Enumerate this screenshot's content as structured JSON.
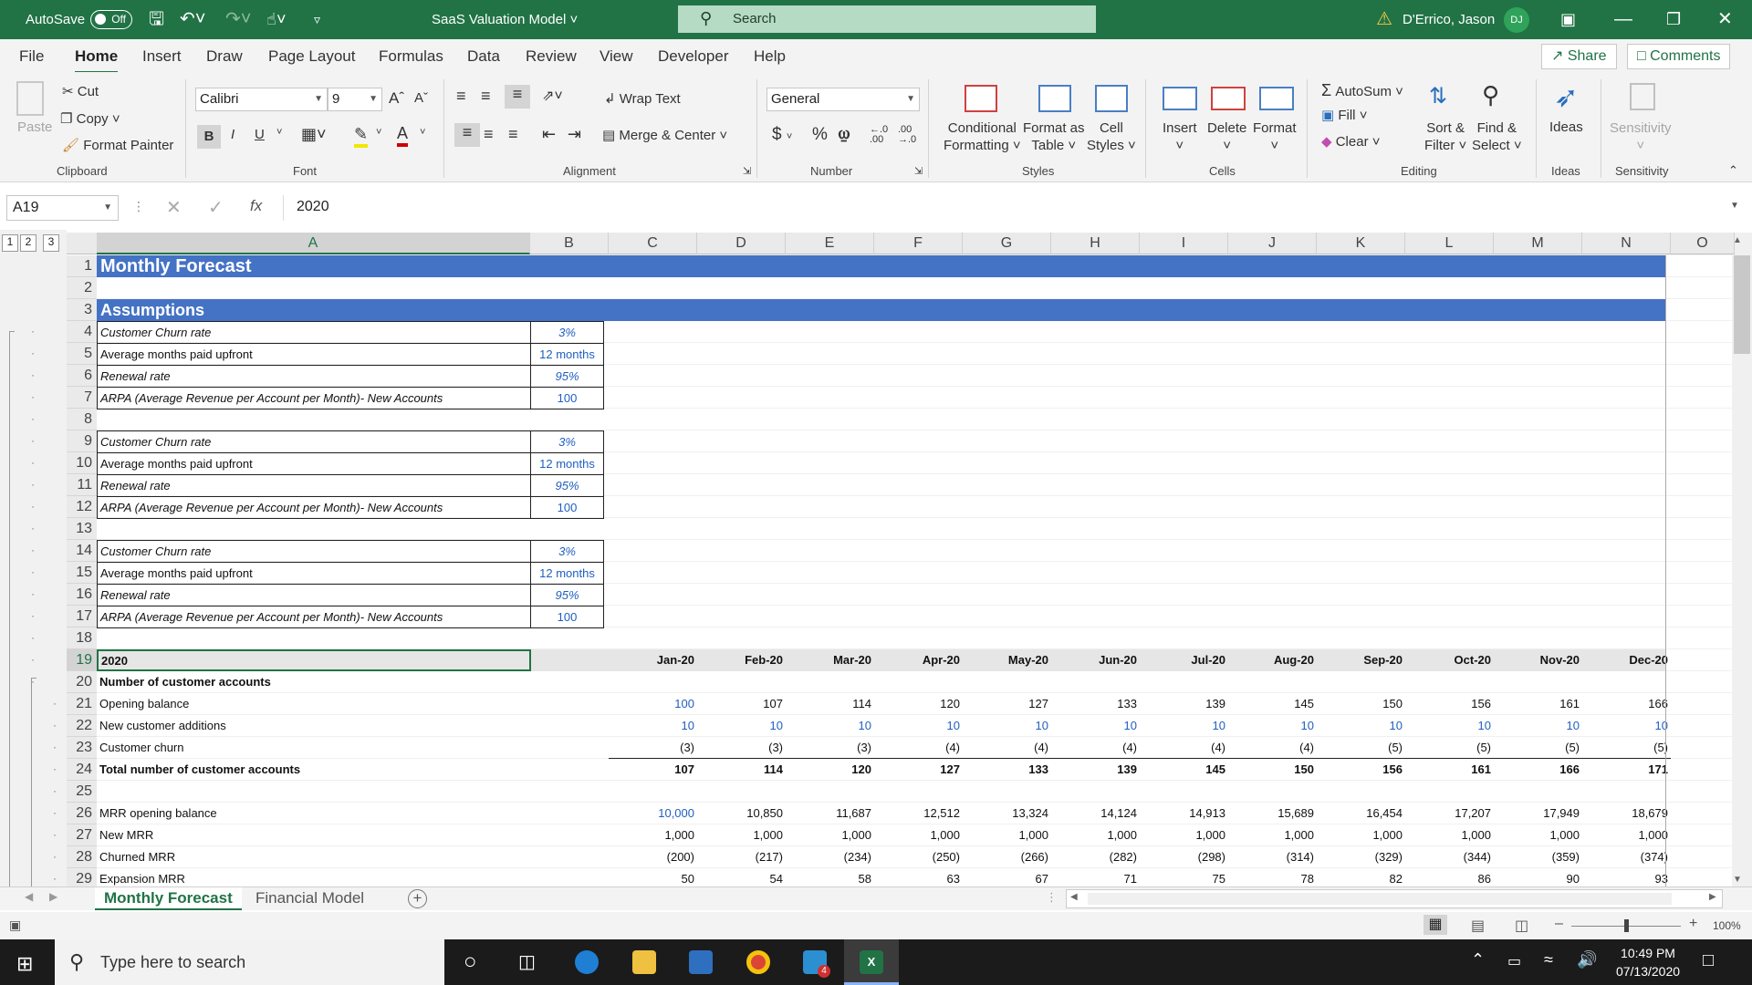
{
  "titlebar": {
    "autosave_label": "AutoSave",
    "autosave_state": "Off",
    "doc_title": "SaaS Valuation Model",
    "search_placeholder": "Search",
    "user_name": "D'Errico, Jason",
    "user_initials": "DJ"
  },
  "menu": {
    "tabs": [
      "File",
      "Home",
      "Insert",
      "Draw",
      "Page Layout",
      "Formulas",
      "Data",
      "Review",
      "View",
      "Developer",
      "Help"
    ],
    "active": "Home",
    "share": "Share",
    "comments": "Comments"
  },
  "ribbon": {
    "clipboard": {
      "paste": "Paste",
      "cut": "Cut",
      "copy": "Copy",
      "format_painter": "Format Painter",
      "label": "Clipboard"
    },
    "font": {
      "name": "Calibri",
      "size": "9",
      "label": "Font",
      "bold": "B",
      "italic": "I",
      "underline": "U"
    },
    "alignment": {
      "wrap": "Wrap Text",
      "merge": "Merge & Center",
      "label": "Alignment"
    },
    "number": {
      "format": "General",
      "label": "Number"
    },
    "styles": {
      "conditional": "Conditional",
      "conditional2": "Formatting",
      "format_as": "Format as",
      "format_as2": "Table",
      "cell_styles": "Cell",
      "cell_styles2": "Styles",
      "label": "Styles"
    },
    "cells": {
      "insert": "Insert",
      "delete": "Delete",
      "format": "Format",
      "label": "Cells"
    },
    "editing": {
      "autosum": "AutoSum",
      "fill": "Fill",
      "clear": "Clear",
      "sort": "Sort &",
      "sort2": "Filter",
      "find": "Find &",
      "find2": "Select",
      "label": "Editing"
    },
    "ideas": {
      "ideas": "Ideas",
      "label": "Ideas"
    },
    "sensitivity": {
      "sensitivity": "Sensitivity",
      "label": "Sensitivity"
    }
  },
  "formula": {
    "namebox": "A19",
    "value": "2020"
  },
  "outline_levels": [
    "1",
    "2",
    "3"
  ],
  "columns": [
    "A",
    "B",
    "C",
    "D",
    "E",
    "F",
    "G",
    "H",
    "I",
    "J",
    "K",
    "L",
    "M",
    "N",
    "O"
  ],
  "rows": [
    "1",
    "2",
    "3",
    "4",
    "5",
    "6",
    "7",
    "8",
    "9",
    "10",
    "11",
    "12",
    "13",
    "14",
    "15",
    "16",
    "17",
    "18",
    "19",
    "20",
    "21",
    "22",
    "23",
    "24",
    "25",
    "26",
    "27",
    "28",
    "29"
  ],
  "sheet": {
    "r1": "Monthly Forecast",
    "r3": "Assumptions",
    "assumption_blocks": [
      [
        [
          "Customer Churn rate",
          "3%"
        ],
        [
          "Average months paid upfront",
          "12 months"
        ],
        [
          "Renewal rate",
          "95%"
        ],
        [
          "ARPA (Average Revenue per Account per Month)- New Accounts",
          "100"
        ]
      ],
      [
        [
          "Customer Churn rate",
          "3%"
        ],
        [
          "Average months paid upfront",
          "12 months"
        ],
        [
          "Renewal rate",
          "95%"
        ],
        [
          "ARPA (Average Revenue per Account per Month)- New Accounts",
          "100"
        ]
      ],
      [
        [
          "Customer Churn rate",
          "3%"
        ],
        [
          "Average months paid upfront",
          "12 months"
        ],
        [
          "Renewal rate",
          "95%"
        ],
        [
          "ARPA (Average Revenue per Account per Month)- New Accounts",
          "100"
        ]
      ]
    ],
    "r19": "2020",
    "months": [
      "Jan-20",
      "Feb-20",
      "Mar-20",
      "Apr-20",
      "May-20",
      "Jun-20",
      "Jul-20",
      "Aug-20",
      "Sep-20",
      "Oct-20",
      "Nov-20",
      "Dec-20"
    ],
    "r20": "Number of customer accounts",
    "data_rows": [
      {
        "label": "Opening balance",
        "vals": [
          "100",
          "107",
          "114",
          "120",
          "127",
          "133",
          "139",
          "145",
          "150",
          "156",
          "161",
          "166"
        ]
      },
      {
        "label": "New customer additions",
        "vals": [
          "10",
          "10",
          "10",
          "10",
          "10",
          "10",
          "10",
          "10",
          "10",
          "10",
          "10",
          "10"
        ]
      },
      {
        "label": "Customer churn",
        "vals": [
          "(3)",
          "(3)",
          "(3)",
          "(4)",
          "(4)",
          "(4)",
          "(4)",
          "(4)",
          "(5)",
          "(5)",
          "(5)",
          "(5)"
        ]
      },
      {
        "label": "Total number of customer accounts",
        "vals": [
          "107",
          "114",
          "120",
          "127",
          "133",
          "139",
          "145",
          "150",
          "156",
          "161",
          "166",
          "171"
        ]
      },
      {
        "label": "",
        "vals": []
      },
      {
        "label": "MRR opening balance",
        "vals": [
          "10,000",
          "10,850",
          "11,687",
          "12,512",
          "13,324",
          "14,124",
          "14,913",
          "15,689",
          "16,454",
          "17,207",
          "17,949",
          "18,679"
        ]
      },
      {
        "label": "New MRR",
        "vals": [
          "1,000",
          "1,000",
          "1,000",
          "1,000",
          "1,000",
          "1,000",
          "1,000",
          "1,000",
          "1,000",
          "1,000",
          "1,000",
          "1,000"
        ]
      },
      {
        "label": "Churned MRR",
        "vals": [
          "(200)",
          "(217)",
          "(234)",
          "(250)",
          "(266)",
          "(282)",
          "(298)",
          "(314)",
          "(329)",
          "(344)",
          "(359)",
          "(374)"
        ]
      },
      {
        "label": "Expansion MRR",
        "vals": [
          "50",
          "54",
          "58",
          "63",
          "67",
          "71",
          "75",
          "78",
          "82",
          "86",
          "90",
          "93"
        ]
      }
    ]
  },
  "sheettabs": [
    "Monthly Forecast",
    "Financial Model"
  ],
  "status": {
    "zoom": "100%"
  },
  "taskbar": {
    "search": "Type here to search",
    "time": "10:49 PM",
    "date": "07/13/2020",
    "badge": "4"
  }
}
